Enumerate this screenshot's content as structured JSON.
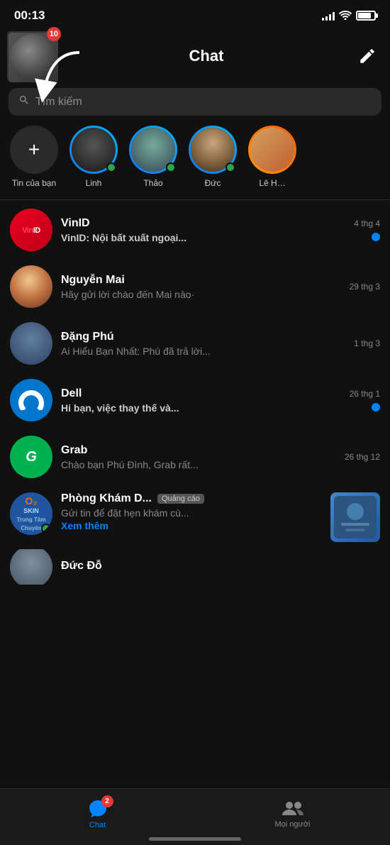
{
  "statusBar": {
    "time": "00:13",
    "battery": 80
  },
  "header": {
    "title": "Chat",
    "badgeCount": "10",
    "composeLabel": "✎"
  },
  "search": {
    "placeholder": "Tìm kiếm"
  },
  "stories": [
    {
      "id": "add",
      "name": "Tin của bạn",
      "type": "add"
    },
    {
      "id": "linh",
      "name": "Linh",
      "type": "story",
      "online": true,
      "faceClass": "face1"
    },
    {
      "id": "thao",
      "name": "Thảo",
      "type": "story",
      "online": true,
      "faceClass": "face2"
    },
    {
      "id": "duc",
      "name": "Đức",
      "type": "story",
      "online": true,
      "faceClass": "face3"
    },
    {
      "id": "lehu",
      "name": "Lê H…",
      "type": "story-partial",
      "online": false,
      "faceClass": "face4"
    }
  ],
  "chats": [
    {
      "id": "vinid",
      "name": "VinID",
      "preview": "VinID: Nội bất xuất ngoại...",
      "time": "4 thg 4",
      "unread": true,
      "bold": true,
      "avatarType": "vinid"
    },
    {
      "id": "mai",
      "name": "Nguyễn Mai",
      "preview": "Hãy gửi lời chào đến Mai nào·",
      "time": "29 thg 3",
      "unread": false,
      "bold": false,
      "avatarType": "mai"
    },
    {
      "id": "phu",
      "name": "Đặng Phú",
      "preview": "Ai Hiểu Bạn Nhất: Phú đã trả lời...",
      "time": "1 thg 3",
      "unread": false,
      "bold": false,
      "avatarType": "phu"
    },
    {
      "id": "dell",
      "name": "Dell",
      "preview": "Hi bạn, việc thay thế và...",
      "time": "26 thg 1",
      "unread": true,
      "bold": true,
      "avatarType": "dell"
    },
    {
      "id": "grab",
      "name": "Grab",
      "preview": "Chào bạn Phú Đình, Grab rất...",
      "time": "26 thg 12",
      "unread": false,
      "bold": false,
      "avatarType": "grab"
    }
  ],
  "adItem": {
    "name": "Phòng Khám D...",
    "adLabel": "Quảng cáo",
    "preview": "Gửi tin để đặt hẹn khám cù...",
    "linkText": "Xem thêm",
    "avatarType": "phongkham"
  },
  "partialItem": {
    "name": "Đức Đỗ",
    "avatarType": "ducdo"
  },
  "bottomNav": {
    "chatLabel": "Chat",
    "chatBadge": "2",
    "peopleLabel": "Mọi người"
  }
}
